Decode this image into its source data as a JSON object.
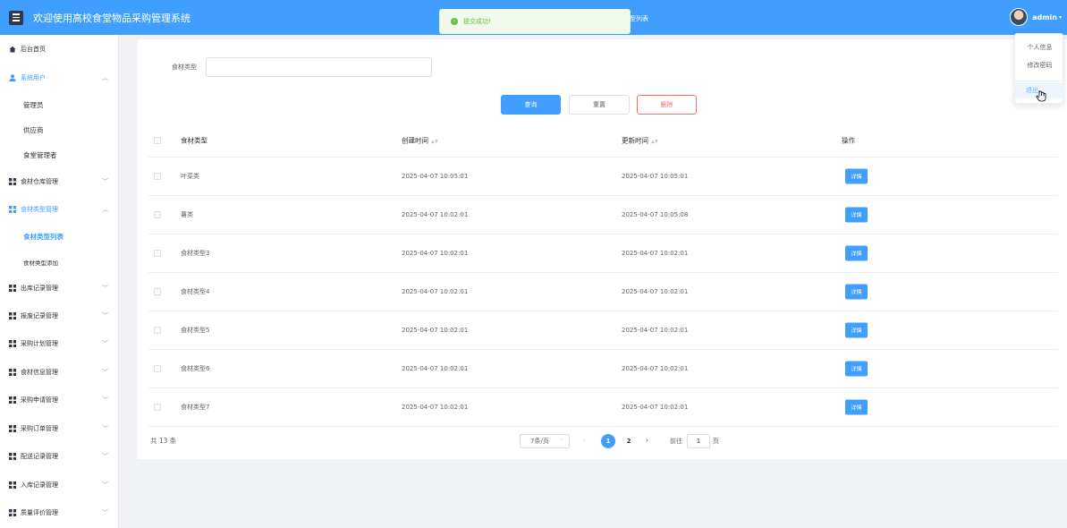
{
  "header": {
    "app_title": "欢迎使用高校食堂物品采购管理系统",
    "page_tag": "型列表",
    "user_name": "admin"
  },
  "toast": {
    "message": "提交成功!"
  },
  "user_menu": {
    "items": [
      "个人信息",
      "修改密码",
      "退出"
    ]
  },
  "sidebar": {
    "home": "后台首页",
    "system_users": "系统用户",
    "system_children": [
      "管理员",
      "供应商",
      "食堂管理者"
    ],
    "groups_a": [
      "食材仓库管理",
      "食材类型管理"
    ],
    "type_children": [
      "食材类型列表",
      "食材类型添加"
    ],
    "groups_b": [
      "出库记录管理",
      "报废记录管理",
      "采购计划管理",
      "食材信息管理",
      "采购申请管理",
      "采购订单管理",
      "配送记录管理",
      "入库记录管理",
      "质量评价管理"
    ]
  },
  "filter": {
    "label": "食材类型",
    "value": ""
  },
  "buttons": {
    "query": "查询",
    "reset": "重置",
    "delete": "删除",
    "detail": "详情"
  },
  "table": {
    "columns": [
      "食材类型",
      "创建时间",
      "更新时间",
      "操作"
    ],
    "rows": [
      {
        "type": "叶菜类",
        "created": "2025-04-07 10:05:01",
        "updated": "2025-04-07 10:05:01"
      },
      {
        "type": "薯类",
        "created": "2025-04-07 10:02:01",
        "updated": "2025-04-07 10:05:08"
      },
      {
        "type": "食材类型3",
        "created": "2025-04-07 10:02:01",
        "updated": "2025-04-07 10:02:01"
      },
      {
        "type": "食材类型4",
        "created": "2025-04-07 10:02:01",
        "updated": "2025-04-07 10:02:01"
      },
      {
        "type": "食材类型5",
        "created": "2025-04-07 10:02:01",
        "updated": "2025-04-07 10:02:01"
      },
      {
        "type": "食材类型6",
        "created": "2025-04-07 10:02:01",
        "updated": "2025-04-07 10:02:01"
      },
      {
        "type": "食材类型7",
        "created": "2025-04-07 10:02:01",
        "updated": "2025-04-07 10:02:01"
      }
    ]
  },
  "pagination": {
    "total_text": "共 13 条",
    "page_size": "7条/页",
    "pages": [
      "1",
      "2"
    ],
    "current": "1",
    "goto_label": "前往",
    "goto_value": "1",
    "goto_unit": "页"
  },
  "colors": {
    "primary": "#409eff",
    "danger": "#f56c6c",
    "success": "#67c23a"
  }
}
